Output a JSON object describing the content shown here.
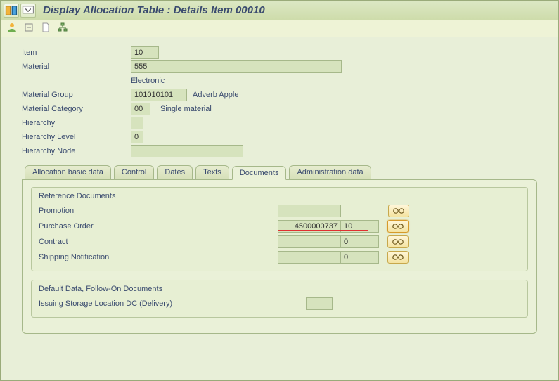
{
  "title": "Display Allocation Table : Details Item 00010",
  "header": {
    "item_label": "Item",
    "item_value": "10",
    "material_label": "Material",
    "material_value": "555",
    "material_desc": "Electronic",
    "material_group_label": "Material Group",
    "material_group_value": "101010101",
    "material_group_desc": "Adverb Apple",
    "material_category_label": "Material Category",
    "material_category_value": "00",
    "material_category_desc": "Single material",
    "hierarchy_label": "Hierarchy",
    "hierarchy_value": "",
    "hierarchy_level_label": "Hierarchy Level",
    "hierarchy_level_value": "0",
    "hierarchy_node_label": "Hierarchy Node",
    "hierarchy_node_value": ""
  },
  "tabs": {
    "t0": "Allocation basic data",
    "t1": "Control",
    "t2": "Dates",
    "t3": "Texts",
    "t4": "Documents",
    "t5": "Administration data"
  },
  "documents": {
    "group1_title": "Reference Documents",
    "promotion_label": "Promotion",
    "promotion_value": "",
    "po_label": "Purchase Order",
    "po_value": "4500000737",
    "po_item": "10",
    "contract_label": "Contract",
    "contract_value": "",
    "contract_item": "0",
    "shipnotif_label": "Shipping Notification",
    "shipnotif_value": "",
    "shipnotif_item": "0",
    "group2_title": "Default Data, Follow-On Documents",
    "issuing_sloc_label": "Issuing Storage Location DC (Delivery)",
    "issuing_sloc_value": ""
  }
}
